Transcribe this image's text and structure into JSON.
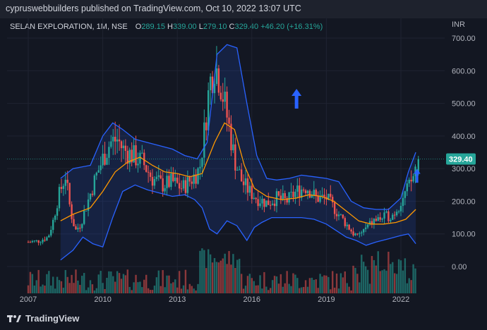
{
  "header": {
    "publisher_text": "cypruswebbuilders published on TradingView.com, Oct 10, 2022 13:07 UTC"
  },
  "legend": {
    "symbol": "SELAN EXPLORATION, 1M, NSE",
    "open_label": "O",
    "open": "289.15",
    "high_label": "H",
    "high": "339.00",
    "low_label": "L",
    "low": "279.10",
    "close_label": "C",
    "close": "329.40",
    "change": "+46.20 (+16.31%)"
  },
  "footer": {
    "brand": "TradingView"
  },
  "colors": {
    "background": "#131722",
    "up": "#26a69a",
    "down": "#ef5350",
    "bb_band": "#2962ff",
    "bb_fill": "#2962ff",
    "bb_basis": "#ff9800",
    "arrow": "#2962ff",
    "price_label": "#26a69a"
  },
  "chart_data": {
    "type": "candlestick",
    "currency": "INR",
    "ylim": [
      -50,
      710
    ],
    "y_ticks": [
      "700.00",
      "600.00",
      "500.00",
      "400.00",
      "300.00",
      "200.00",
      "100.00",
      "0.00"
    ],
    "y_tick_values": [
      700,
      600,
      500,
      400,
      300,
      200,
      100,
      0
    ],
    "x_ticks": [
      "2007",
      "2010",
      "2013",
      "2016",
      "2019",
      "2022"
    ],
    "x_tick_years": [
      2007,
      2010,
      2013,
      2016,
      2019,
      2022
    ],
    "xlim": [
      2006.5,
      2023.0
    ],
    "last_price_label": "329.40",
    "last_price": 329.4,
    "ohlc_anchors": [
      [
        2007.0,
        75
      ],
      [
        2007.4,
        78
      ],
      [
        2007.8,
        90
      ],
      [
        2008.0,
        140
      ],
      [
        2008.2,
        210
      ],
      [
        2008.5,
        280
      ],
      [
        2008.7,
        170
      ],
      [
        2008.9,
        110
      ],
      [
        2009.1,
        130
      ],
      [
        2009.4,
        200
      ],
      [
        2009.7,
        270
      ],
      [
        2010.0,
        330
      ],
      [
        2010.3,
        380
      ],
      [
        2010.6,
        390
      ],
      [
        2010.8,
        360
      ],
      [
        2011.2,
        340
      ],
      [
        2011.6,
        320
      ],
      [
        2012.0,
        270
      ],
      [
        2012.4,
        250
      ],
      [
        2012.8,
        260
      ],
      [
        2013.2,
        240
      ],
      [
        2013.6,
        270
      ],
      [
        2013.9,
        300
      ],
      [
        2014.1,
        420
      ],
      [
        2014.3,
        560
      ],
      [
        2014.5,
        620
      ],
      [
        2014.7,
        580
      ],
      [
        2014.9,
        500
      ],
      [
        2015.1,
        420
      ],
      [
        2015.3,
        330
      ],
      [
        2015.6,
        260
      ],
      [
        2015.9,
        230
      ],
      [
        2016.2,
        210
      ],
      [
        2016.6,
        195
      ],
      [
        2017.0,
        210
      ],
      [
        2017.4,
        200
      ],
      [
        2017.8,
        230
      ],
      [
        2018.2,
        245
      ],
      [
        2018.6,
        210
      ],
      [
        2019.0,
        210
      ],
      [
        2019.4,
        170
      ],
      [
        2019.8,
        130
      ],
      [
        2020.2,
        90
      ],
      [
        2020.5,
        110
      ],
      [
        2020.9,
        140
      ],
      [
        2021.3,
        150
      ],
      [
        2021.7,
        160
      ],
      [
        2022.0,
        200
      ],
      [
        2022.3,
        240
      ],
      [
        2022.55,
        283
      ],
      [
        2022.62,
        329.4
      ]
    ],
    "bb_upper": [
      [
        2008.3,
        270
      ],
      [
        2008.8,
        300
      ],
      [
        2009.5,
        310
      ],
      [
        2010.0,
        400
      ],
      [
        2010.4,
        440
      ],
      [
        2010.8,
        420
      ],
      [
        2011.3,
        390
      ],
      [
        2011.8,
        380
      ],
      [
        2012.3,
        370
      ],
      [
        2012.8,
        360
      ],
      [
        2013.3,
        340
      ],
      [
        2013.8,
        330
      ],
      [
        2014.2,
        380
      ],
      [
        2014.6,
        650
      ],
      [
        2015.0,
        680
      ],
      [
        2015.4,
        670
      ],
      [
        2015.8,
        500
      ],
      [
        2016.2,
        340
      ],
      [
        2016.6,
        270
      ],
      [
        2017.0,
        265
      ],
      [
        2017.5,
        270
      ],
      [
        2018.0,
        280
      ],
      [
        2018.5,
        275
      ],
      [
        2019.0,
        270
      ],
      [
        2019.5,
        260
      ],
      [
        2020.0,
        200
      ],
      [
        2020.5,
        180
      ],
      [
        2021.0,
        175
      ],
      [
        2021.5,
        175
      ],
      [
        2022.0,
        210
      ],
      [
        2022.3,
        290
      ],
      [
        2022.6,
        350
      ]
    ],
    "bb_lower": [
      [
        2008.3,
        20
      ],
      [
        2008.8,
        50
      ],
      [
        2009.2,
        90
      ],
      [
        2009.6,
        70
      ],
      [
        2010.0,
        60
      ],
      [
        2010.4,
        150
      ],
      [
        2010.8,
        230
      ],
      [
        2011.3,
        250
      ],
      [
        2011.8,
        235
      ],
      [
        2012.3,
        225
      ],
      [
        2012.8,
        215
      ],
      [
        2013.3,
        220
      ],
      [
        2013.7,
        205
      ],
      [
        2014.0,
        180
      ],
      [
        2014.3,
        115
      ],
      [
        2014.6,
        100
      ],
      [
        2015.0,
        140
      ],
      [
        2015.4,
        125
      ],
      [
        2015.8,
        80
      ],
      [
        2016.1,
        120
      ],
      [
        2016.4,
        135
      ],
      [
        2016.8,
        150
      ],
      [
        2017.4,
        150
      ],
      [
        2018.0,
        150
      ],
      [
        2018.5,
        145
      ],
      [
        2019.0,
        130
      ],
      [
        2019.4,
        110
      ],
      [
        2019.8,
        90
      ],
      [
        2020.2,
        80
      ],
      [
        2020.6,
        65
      ],
      [
        2021.0,
        75
      ],
      [
        2021.5,
        85
      ],
      [
        2022.0,
        95
      ],
      [
        2022.3,
        100
      ],
      [
        2022.6,
        70
      ]
    ],
    "bb_basis": [
      [
        2008.3,
        140
      ],
      [
        2008.8,
        160
      ],
      [
        2009.5,
        180
      ],
      [
        2010.0,
        230
      ],
      [
        2010.5,
        290
      ],
      [
        2011.0,
        320
      ],
      [
        2011.5,
        335
      ],
      [
        2012.0,
        310
      ],
      [
        2012.5,
        290
      ],
      [
        2013.0,
        285
      ],
      [
        2013.5,
        275
      ],
      [
        2014.0,
        285
      ],
      [
        2014.5,
        380
      ],
      [
        2014.9,
        440
      ],
      [
        2015.3,
        420
      ],
      [
        2015.7,
        310
      ],
      [
        2016.1,
        240
      ],
      [
        2016.6,
        215
      ],
      [
        2017.2,
        205
      ],
      [
        2017.8,
        210
      ],
      [
        2018.3,
        220
      ],
      [
        2018.8,
        215
      ],
      [
        2019.3,
        200
      ],
      [
        2019.8,
        170
      ],
      [
        2020.3,
        140
      ],
      [
        2020.8,
        130
      ],
      [
        2021.3,
        130
      ],
      [
        2021.8,
        135
      ],
      [
        2022.2,
        145
      ],
      [
        2022.6,
        175
      ]
    ],
    "volume_scale": 0.2,
    "arrows": [
      {
        "x": 2017.8,
        "y": 510,
        "dir": "up"
      },
      {
        "x": 2022.65,
        "y": 275,
        "dir": "up"
      }
    ]
  }
}
